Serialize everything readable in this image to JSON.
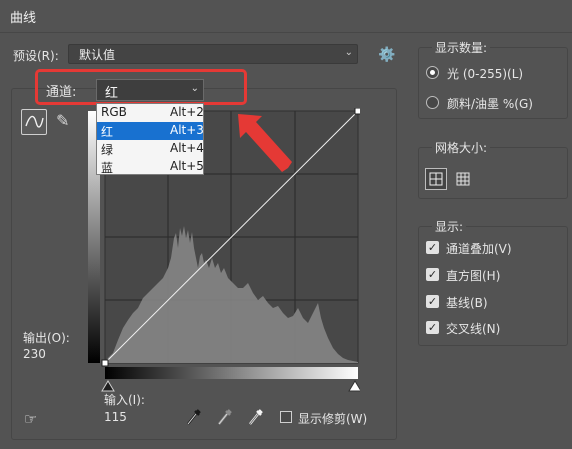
{
  "window": {
    "title": "曲线"
  },
  "preset": {
    "label": "预设(R):",
    "value": "默认值"
  },
  "channel": {
    "label": "通道:",
    "value": "红",
    "options": [
      {
        "name": "RGB",
        "shortcut": "Alt+2"
      },
      {
        "name": "红",
        "shortcut": "Alt+3"
      },
      {
        "name": "绿",
        "shortcut": "Alt+4"
      },
      {
        "name": "蓝",
        "shortcut": "Alt+5"
      }
    ]
  },
  "output": {
    "label": "输出(O):",
    "value": "230"
  },
  "input": {
    "label": "输入(I):",
    "value": "115"
  },
  "show_clipping": {
    "label": "显示修剪(W)",
    "checked": false
  },
  "show_amount": {
    "title": "显示数量:",
    "options": [
      {
        "label": "光 (0-255)(L)",
        "selected": true
      },
      {
        "label": "颜料/油墨 %(G)",
        "selected": false
      }
    ]
  },
  "grid_size": {
    "title": "网格大小:"
  },
  "show": {
    "title": "显示:",
    "options": [
      {
        "label": "通道叠加(V)",
        "checked": true
      },
      {
        "label": "直方图(H)",
        "checked": true
      },
      {
        "label": "基线(B)",
        "checked": true
      },
      {
        "label": "交叉线(N)",
        "checked": true
      }
    ]
  },
  "icons": {
    "gear": "gear-icon",
    "curve_tool": "curve-tool-icon",
    "pencil_tool": "pencil-icon",
    "hand_tool": "target-adjust-hand-icon",
    "black_point": "black-eyedropper-icon",
    "gray_point": "gray-eyedropper-icon",
    "white_point": "white-eyedropper-icon"
  },
  "colors": {
    "background": "#535353",
    "highlight": "#e53935",
    "selection": "#1871d0"
  }
}
